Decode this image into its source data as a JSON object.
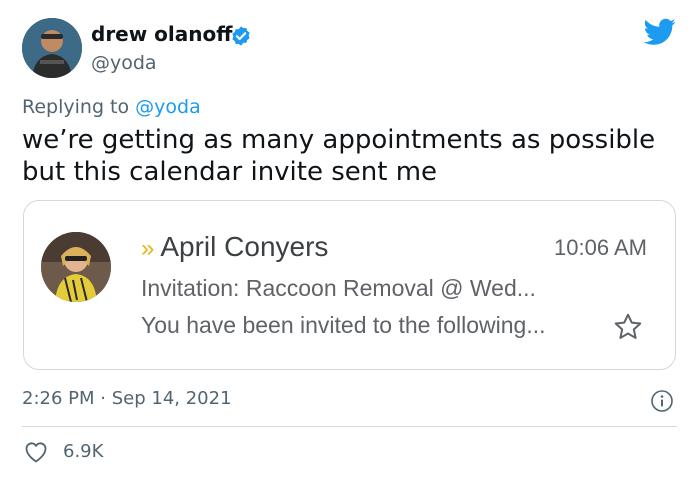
{
  "tweet": {
    "author_name": "drew olanoff",
    "author_handle": "@yoda",
    "verified": true,
    "reply_prefix": "Replying to",
    "reply_to": "@yoda",
    "text": "we’re getting as many appointments as possible but this calendar invite sent me",
    "time": "2:26 PM",
    "separator": "·",
    "date": "Sep 14, 2021",
    "likes": "6.9K"
  },
  "email_card": {
    "chevron": "»",
    "sender": "April Conyers",
    "time": "10:06 AM",
    "subject": "Invitation: Raccoon Removal  @ Wed...",
    "snippet": "You have been invited to the following..."
  },
  "icons": {
    "verified": "verified-badge-icon",
    "bird": "twitter-bird-icon",
    "star": "star-outline-icon",
    "info": "info-icon",
    "like": "heart-outline-icon"
  },
  "colors": {
    "twitter_blue": "#1d9bf0",
    "text_primary": "#0f1419",
    "text_secondary": "#536471",
    "gmail_important": "#e8b416"
  }
}
